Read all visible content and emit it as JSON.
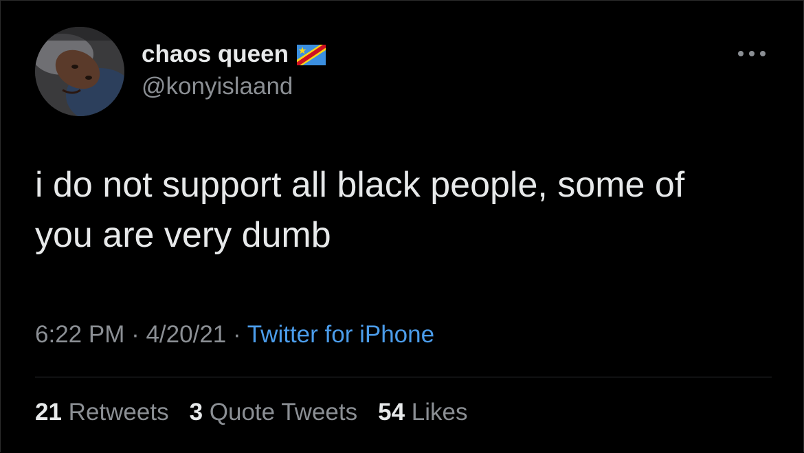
{
  "tweet": {
    "author": {
      "display_name": "chaos queen",
      "handle": "@konyislaand",
      "flag_emoji": "🇨🇩",
      "avatar_icon": "avatar-photo"
    },
    "more_icon": "ellipsis-icon",
    "text": "i do not support all black people, some of\nyou are very dumb",
    "time": "6:22 PM",
    "separator": " · ",
    "date": "4/20/21",
    "source": "Twitter for iPhone",
    "stats": {
      "retweets_count": "21",
      "retweets_label": "Retweets",
      "quotes_count": "3",
      "quotes_label": "Quote Tweets",
      "likes_count": "54",
      "likes_label": "Likes"
    }
  },
  "colors": {
    "background": "#000000",
    "primary_text": "#e7e9ea",
    "secondary_text": "#8b8f94",
    "link": "#4b9cea",
    "divider": "#303336"
  }
}
